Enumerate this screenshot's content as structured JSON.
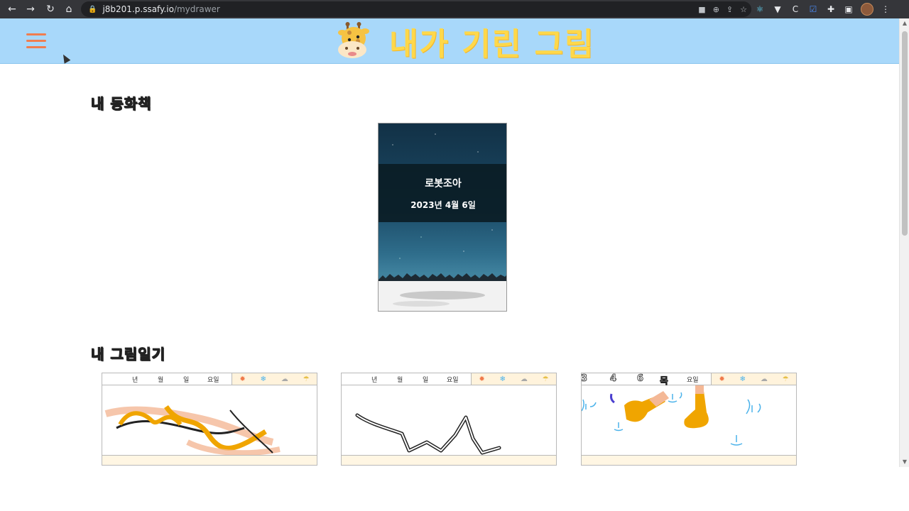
{
  "browser": {
    "url_host": "j8b201.p.ssafy.io",
    "url_path": "/mydrawer"
  },
  "header": {
    "title": "내가 기린 그림"
  },
  "sections": {
    "storybook_title": "내 동화책",
    "diary_title": "내 그림일기"
  },
  "storybook": {
    "title": "로봇조아",
    "date": "2023년 4월 6일"
  },
  "diary_header": {
    "year": "년",
    "month": "월",
    "day": "일",
    "weekday": "요일"
  },
  "diaries": [
    {
      "handwritten_date": [
        "",
        "",
        "",
        ""
      ]
    },
    {
      "handwritten_date": [
        "",
        "",
        "",
        ""
      ]
    },
    {
      "handwritten_date": [
        "23",
        "4",
        "6",
        "목"
      ]
    }
  ],
  "weather_icons": [
    "sun-icon",
    "snow-icon",
    "cloud-icon",
    "umbrella-icon"
  ],
  "colors": {
    "header_bg": "#a8d8fa",
    "logo_yellow": "#ffd84a",
    "menu_orange": "#f07d4f"
  }
}
